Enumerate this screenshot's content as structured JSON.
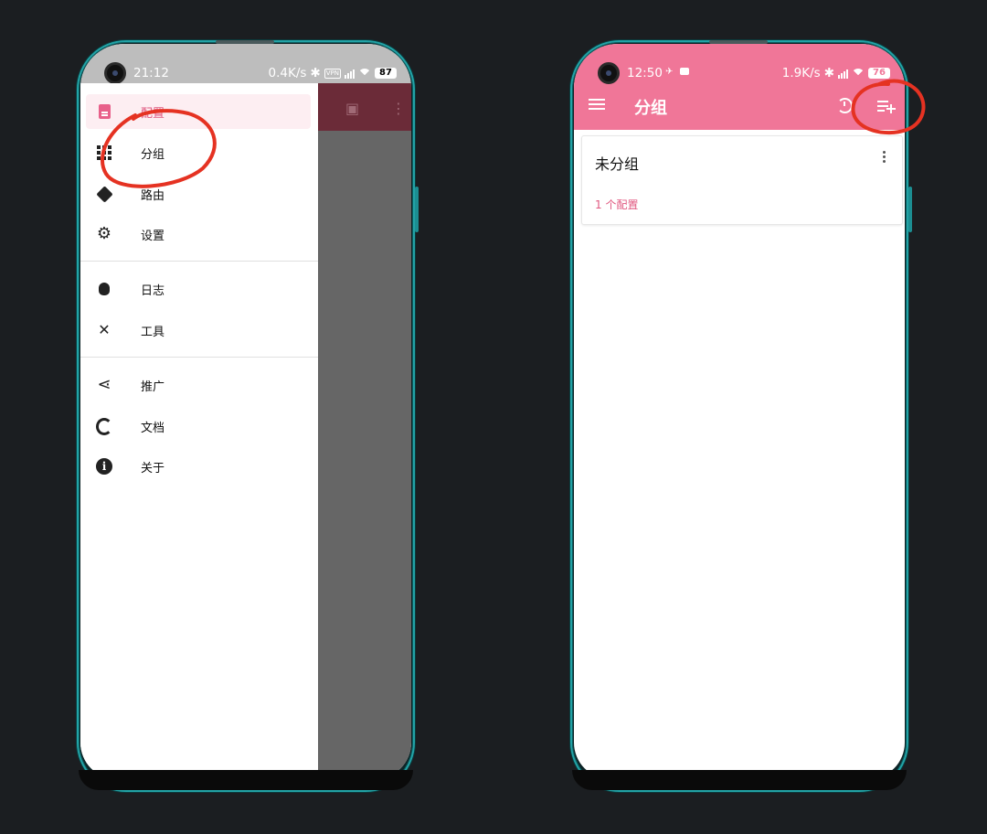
{
  "left_phone": {
    "status": {
      "time": "21:12",
      "speed": "0.4K/s",
      "vpn": "VPN",
      "battery": "87"
    },
    "drawer": {
      "items": [
        {
          "label": "配置",
          "icon": "document-icon",
          "active": true
        },
        {
          "label": "分组",
          "icon": "grid-icon"
        },
        {
          "label": "路由",
          "icon": "route-icon"
        },
        {
          "label": "设置",
          "icon": "gear-icon"
        },
        {
          "label": "日志",
          "icon": "bug-icon"
        },
        {
          "label": "工具",
          "icon": "tools-icon"
        },
        {
          "label": "推广",
          "icon": "share-icon"
        },
        {
          "label": "文档",
          "icon": "ring-icon"
        },
        {
          "label": "关于",
          "icon": "info-icon"
        }
      ]
    }
  },
  "right_phone": {
    "status": {
      "time": "12:50",
      "speed": "1.9K/s",
      "battery": "76"
    },
    "toolbar": {
      "title": "分组"
    },
    "groups": [
      {
        "name": "未分组",
        "count_text": "1 个配置"
      }
    ]
  },
  "colors": {
    "accent": "#f07698",
    "annotation": "#e53222",
    "background": "#1b1e21",
    "frame": "#22a3a6"
  }
}
